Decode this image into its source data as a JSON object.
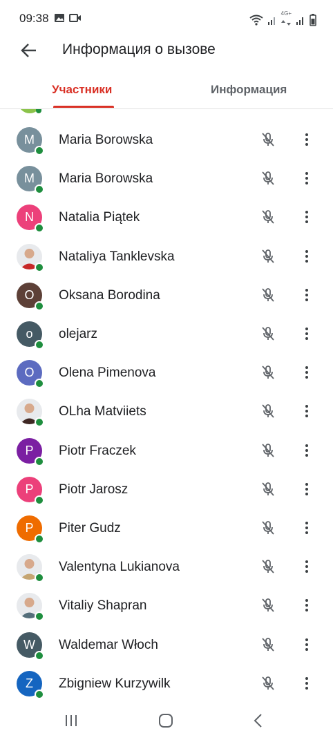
{
  "status_bar": {
    "time": "09:38",
    "network_label": "4G+",
    "icons": [
      "image-icon",
      "video-icon",
      "wifi-icon",
      "signal-icon",
      "signal-icon",
      "battery-icon"
    ]
  },
  "header": {
    "title": "Информация о вызове",
    "back_icon": "arrow-back-icon"
  },
  "tabs": [
    {
      "label": "Участники",
      "active": true
    },
    {
      "label": "Информация",
      "active": false
    }
  ],
  "colors": {
    "accent": "#d93025",
    "online": "#1e8e3e"
  },
  "participants": [
    {
      "name": "Maria Borowska",
      "initial": "M",
      "color": "#78909c",
      "photo": false
    },
    {
      "name": "Maria Borowska",
      "initial": "M",
      "color": "#78909c",
      "photo": false
    },
    {
      "name": "Natalia Piątek",
      "initial": "N",
      "color": "#ec407a",
      "photo": false
    },
    {
      "name": "Nataliya Tanklevska",
      "initial": "",
      "color": "#c62828",
      "photo": true
    },
    {
      "name": "Oksana Borodina",
      "initial": "O",
      "color": "#5d4037",
      "photo": false
    },
    {
      "name": "olejarz",
      "initial": "o",
      "color": "#455a64",
      "photo": false
    },
    {
      "name": "Olena Pimenova",
      "initial": "O",
      "color": "#5c6bc0",
      "photo": false
    },
    {
      "name": "OLha Matviiets",
      "initial": "",
      "color": "#3e2723",
      "photo": true
    },
    {
      "name": "Piotr Fraczek",
      "initial": "P",
      "color": "#7b1fa2",
      "photo": false
    },
    {
      "name": "Piotr Jarosz",
      "initial": "P",
      "color": "#ec407a",
      "photo": false
    },
    {
      "name": "Piter Gudz",
      "initial": "P",
      "color": "#ef6c00",
      "photo": false
    },
    {
      "name": "Valentyna Lukianova",
      "initial": "",
      "color": "#c5a572",
      "photo": true
    },
    {
      "name": "Vitaliy Shapran",
      "initial": "",
      "color": "#546e7a",
      "photo": true
    },
    {
      "name": "Waldemar Włoch",
      "initial": "W",
      "color": "#455a64",
      "photo": false
    },
    {
      "name": "Zbigniew Kurzywilk",
      "initial": "Z",
      "color": "#1565c0",
      "photo": false
    }
  ],
  "row_icons": {
    "mic": "mic-off-icon",
    "menu": "more-vert-icon"
  }
}
